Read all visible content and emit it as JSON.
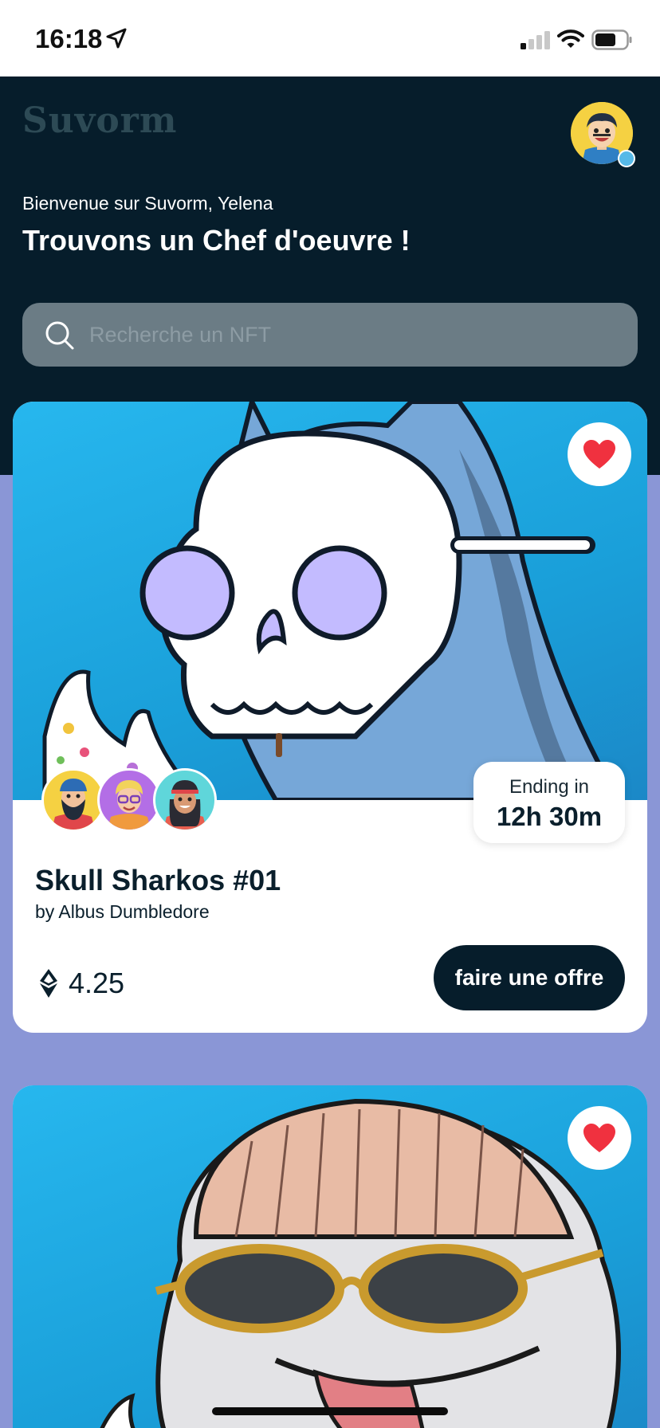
{
  "status_bar": {
    "time": "16:18",
    "icons": [
      "location-arrow-icon",
      "cellular-signal-icon",
      "wifi-icon",
      "battery-icon"
    ]
  },
  "header": {
    "logo": "Suvorm",
    "welcome": "Bienvenue sur Suvorm, Yelena",
    "title": "Trouvons un Chef d'oeuvre !",
    "avatar_icon": "user-avatar-icon"
  },
  "search": {
    "placeholder": "Recherche un NFT",
    "value": ""
  },
  "cards": [
    {
      "art_icon": "skull-shark-artwork",
      "favorite_icon": "heart-icon",
      "bidders": [
        "bidder-avatar-bearded",
        "bidder-avatar-glasses",
        "bidder-avatar-headband"
      ],
      "timer_label": "Ending in",
      "timer_value": "12h 30m",
      "title": "Skull Sharkos #01",
      "author": "by Albus Dumbledore",
      "price": "4.25",
      "currency_icon": "ethereum-icon",
      "offer_label": "faire une offre"
    },
    {
      "art_icon": "bowl-cut-shark-artwork",
      "favorite_icon": "heart-icon"
    }
  ],
  "colors": {
    "header_bg": "#061d2b",
    "page_bg": "#8a96d6",
    "art_bg": "#1ea8e4",
    "heart": "#f0313f",
    "button_bg": "#061d2b"
  }
}
